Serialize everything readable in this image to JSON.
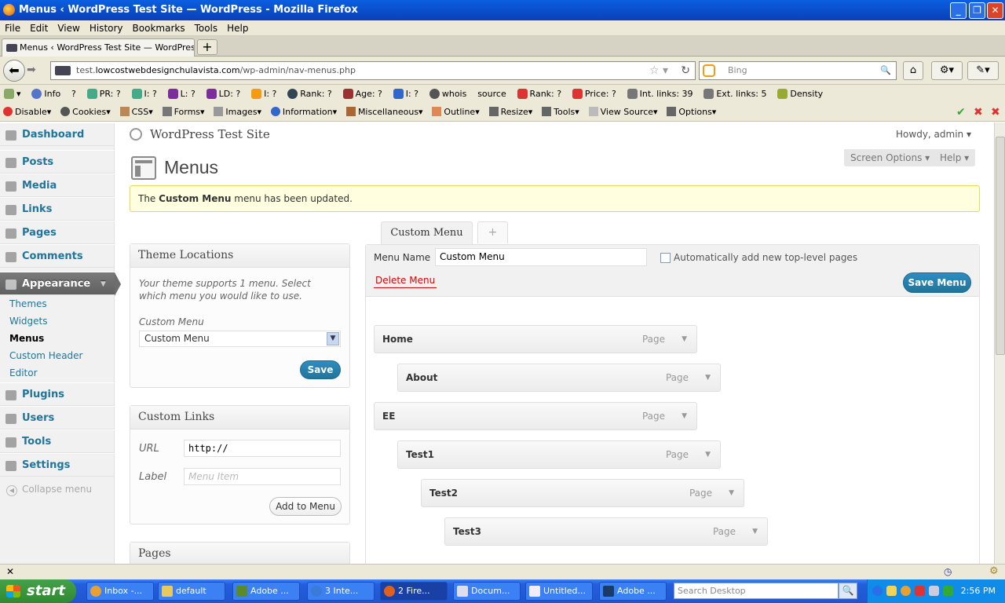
{
  "window": {
    "title": "Menus ‹ WordPress Test Site — WordPress - Mozilla Firefox",
    "min": "_",
    "max": "❐",
    "close": "✕"
  },
  "menubar": [
    "File",
    "Edit",
    "View",
    "History",
    "Bookmarks",
    "Tools",
    "Help"
  ],
  "tabs": [
    {
      "label": "Menus ‹ WordPress Test Site — WordPress"
    }
  ],
  "newtab": "+",
  "nav": {
    "back": "⬅",
    "forward": "➡",
    "url_prefix": "test.",
    "url_domain": "lowcostwebdesignchulavista.com",
    "url_path": "/wp-admin/nav-menus.php",
    "search_placeholder": "Bing",
    "star": "☆ ▾",
    "reload": "↻",
    "mag": "🔍",
    "home": "⌂"
  },
  "toolbar1": [
    "Info",
    "?",
    "PR: ?",
    "I: ?",
    "L: ?",
    "LD: ?",
    "I: ?",
    "Rank: ?",
    "Age: ?",
    "I: ?",
    "whois",
    "source",
    "Rank: ?",
    "Price: ?",
    "Int. links: 39",
    "Ext. links: 5",
    "Density"
  ],
  "toolbar2": [
    "Disable▾",
    "Cookies▾",
    "CSS▾",
    "Forms▾",
    "Images▾",
    "Information▾",
    "Miscellaneous▾",
    "Outline▾",
    "Resize▾",
    "Tools▾",
    "View Source▾",
    "Options▾"
  ],
  "wp": {
    "site_name": "WordPress Test Site",
    "howdy": "Howdy, admin ▾",
    "screen_options": "Screen Options ▾",
    "help": "Help ▾",
    "page_title": "Menus",
    "notice_pre": "The ",
    "notice_bold": "Custom Menu",
    "notice_post": " menu has been updated.",
    "sidebar": {
      "dashboard": "Dashboard",
      "posts": "Posts",
      "media": "Media",
      "links": "Links",
      "pages": "Pages",
      "comments": "Comments",
      "appearance": "Appearance",
      "appearance_arrow": "▼",
      "sub": [
        "Themes",
        "Widgets",
        "Menus",
        "Custom Header",
        "Editor"
      ],
      "plugins": "Plugins",
      "users": "Users",
      "tools": "Tools",
      "settings": "Settings",
      "collapse_icon": "◀",
      "collapse": "Collapse menu"
    },
    "theme_locations": {
      "title": "Theme Locations",
      "desc": "Your theme supports 1 menu. Select which menu you would like to use.",
      "label": "Custom Menu",
      "selected": "Custom Menu",
      "save": "Save"
    },
    "custom_links": {
      "title": "Custom Links",
      "url_label": "URL",
      "url_value": "http://",
      "label_label": "Label",
      "label_placeholder": "Menu Item",
      "add": "Add to Menu"
    },
    "pages_box": {
      "title": "Pages"
    },
    "menu_tab": "Custom Menu",
    "add_tab": "+",
    "menu_name_label": "Menu Name",
    "menu_name_value": "Custom Menu",
    "auto_add_label": "Automatically add new top-level pages",
    "delete_menu": "Delete Menu",
    "save_menu": "Save Menu",
    "items": [
      {
        "title": "Home",
        "type": "Page"
      },
      {
        "title": "About",
        "type": "Page"
      },
      {
        "title": "EE",
        "type": "Page"
      },
      {
        "title": "Test1",
        "type": "Page"
      },
      {
        "title": "Test2",
        "type": "Page"
      },
      {
        "title": "Test3",
        "type": "Page"
      }
    ],
    "item_arrow": "▼"
  },
  "findbar": {
    "close": "✕"
  },
  "taskbar": {
    "start": "start",
    "tasks": [
      "Inbox -...",
      "default",
      "Adobe ...",
      "3 Inte...",
      "2 Fire...",
      "Docum...",
      "Untitled...",
      "Adobe ..."
    ],
    "search_placeholder": "Search Desktop",
    "search_btn": "🔍",
    "clock": "2:56 PM"
  }
}
